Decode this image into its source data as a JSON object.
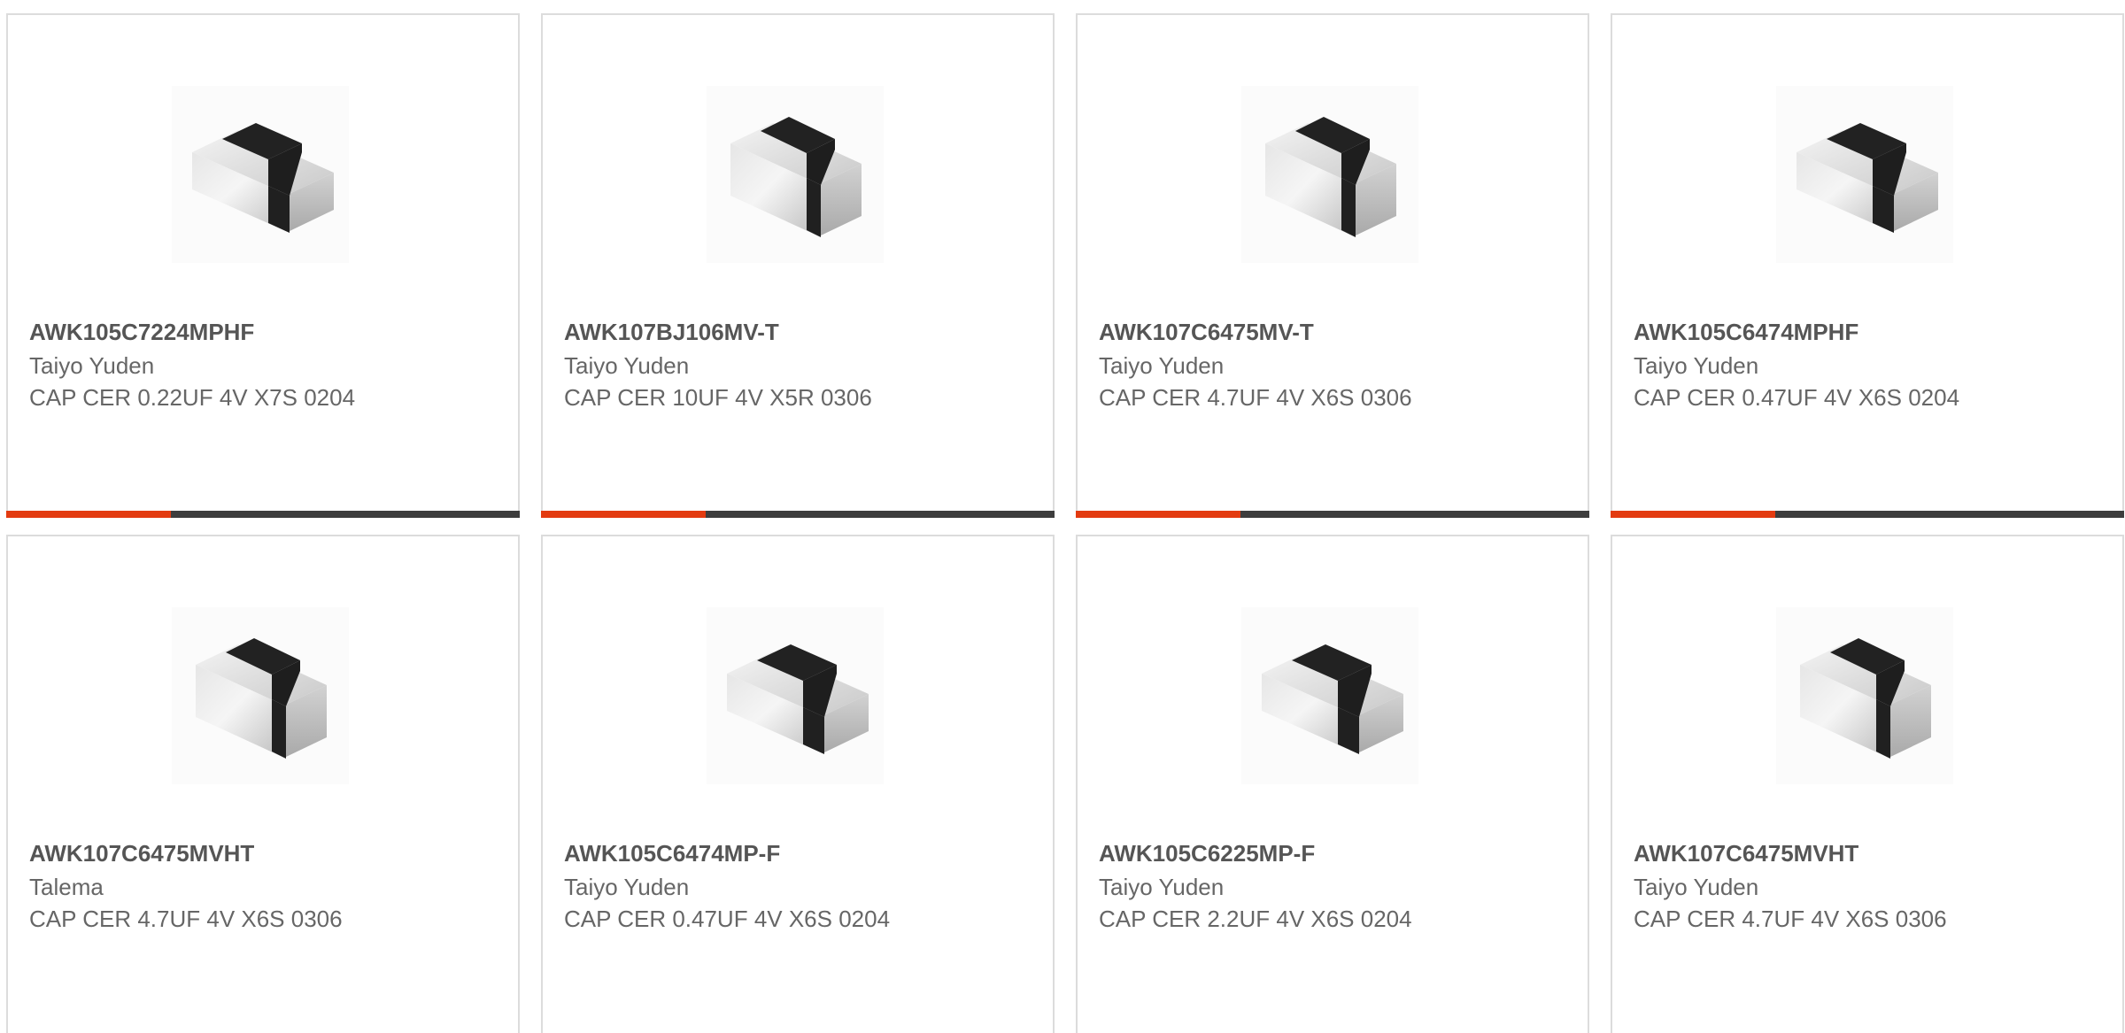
{
  "colors": {
    "accent": "#e33b10",
    "bar_dark": "#3d3d3d",
    "title": "#555555",
    "text": "#666666",
    "border": "#dcdcdc"
  },
  "progress_accent_fraction": 0.32,
  "products": [
    {
      "part": "AWK105C7224MPHF",
      "manufacturer": "Taiyo Yuden",
      "description": "CAP CER 0.22UF 4V X7S 0204",
      "image_icon": "capacitor-chip-image"
    },
    {
      "part": "AWK107BJ106MV-T",
      "manufacturer": "Taiyo Yuden",
      "description": "CAP CER 10UF 4V X5R 0306",
      "image_icon": "capacitor-chip-image"
    },
    {
      "part": "AWK107C6475MV-T",
      "manufacturer": "Taiyo Yuden",
      "description": "CAP CER 4.7UF 4V X6S 0306",
      "image_icon": "capacitor-chip-image"
    },
    {
      "part": "AWK105C6474MPHF",
      "manufacturer": "Taiyo Yuden",
      "description": "CAP CER 0.47UF 4V X6S 0204",
      "image_icon": "capacitor-chip-image"
    },
    {
      "part": "AWK107C6475MVHT",
      "manufacturer": "Talema",
      "description": "CAP CER 4.7UF 4V X6S 0306",
      "image_icon": "capacitor-chip-image"
    },
    {
      "part": "AWK105C6474MP-F",
      "manufacturer": "Taiyo Yuden",
      "description": "CAP CER 0.47UF 4V X6S 0204",
      "image_icon": "capacitor-chip-image"
    },
    {
      "part": "AWK105C6225MP-F",
      "manufacturer": "Taiyo Yuden",
      "description": "CAP CER 2.2UF 4V X6S 0204",
      "image_icon": "capacitor-chip-image"
    },
    {
      "part": "AWK107C6475MVHT",
      "manufacturer": "Taiyo Yuden",
      "description": "CAP CER 4.7UF 4V X6S 0306",
      "image_icon": "capacitor-chip-image"
    }
  ]
}
